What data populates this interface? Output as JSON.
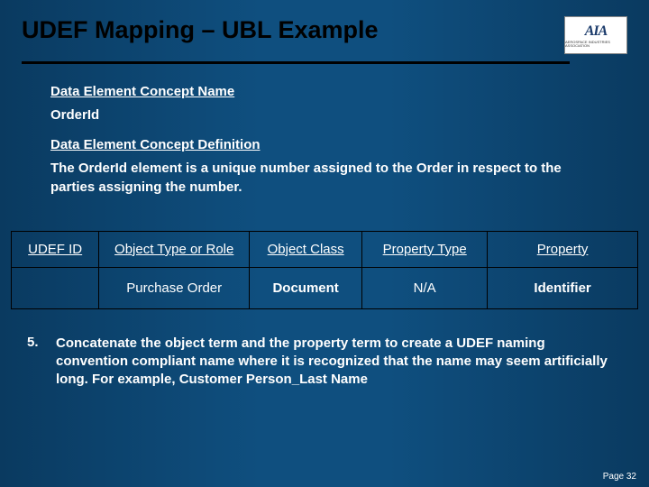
{
  "header": {
    "title": "UDEF Mapping – UBL Example",
    "logo_text": "AIA",
    "logo_sub": "AEROSPACE INDUSTRIES ASSOCIATION"
  },
  "sections": {
    "name_head": "Data Element Concept Name",
    "name_body": "OrderId",
    "def_head": "Data Element Concept Definition",
    "def_body": "The OrderId element is a unique number assigned to the Order in respect to the parties assigning the number."
  },
  "table": {
    "headers": {
      "udef_id": "UDEF ID",
      "obj_type": "Object Type or Role",
      "obj_class": "Object Class",
      "prop_type": "Property Type",
      "prop": "Property"
    },
    "row": {
      "udef_id": "",
      "obj_type": "Purchase Order",
      "obj_class": "Document",
      "prop_type": "N/A",
      "prop": "Identifier"
    }
  },
  "step": {
    "num": "5.",
    "text": "Concatenate the object term and the property term to create a UDEF naming convention compliant name where it is recognized that the name may seem artificially long. For example, Customer Person_Last Name"
  },
  "footer": {
    "page": "Page 32"
  }
}
